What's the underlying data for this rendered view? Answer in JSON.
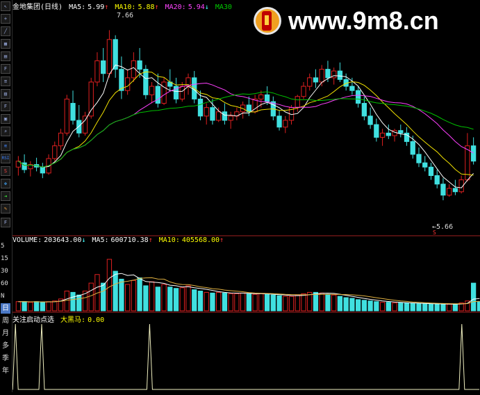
{
  "price_header": {
    "stock": "金地集团",
    "period": "(日线)",
    "ma5_label": "MA5:",
    "ma5": "5.99",
    "ma10_label": "MA10:",
    "ma10": "5.88",
    "ma20_label": "MA20:",
    "ma20": "5.94",
    "ma30_label": "MA30"
  },
  "annotations": {
    "high": "7.66",
    "low": "←5.66",
    "marker": "S"
  },
  "volume_header": {
    "label": "VOLUME:",
    "value": "203643.00",
    "ma5_label": "MA5:",
    "ma5": "600710.38",
    "ma10_label": "MA10:",
    "ma10": "405568.00"
  },
  "indicator_header": {
    "label": "关注启动点选",
    "name": "大黑马:",
    "value": "0.00"
  },
  "watermark": {
    "url": "www.9m8.cn"
  },
  "sidebar": {
    "tools": [
      "RSI",
      "S"
    ],
    "labels": [
      "5",
      "15",
      "30",
      "60",
      "N"
    ],
    "periods": [
      "日",
      "周",
      "月",
      "多",
      "季",
      "年"
    ]
  },
  "colors": {
    "up": "#e02020",
    "down": "#40e0e0",
    "ma5": "#ffffff",
    "ma10": "#f0e000",
    "ma20": "#ff40ff",
    "ma30": "#00c000",
    "vol_line": "#e0b040"
  },
  "chart_data": {
    "type": "candlestick",
    "price_range": [
      5.3,
      7.9
    ],
    "ohlc": [
      {
        "o": 6.05,
        "h": 6.18,
        "l": 5.95,
        "c": 6.12
      },
      {
        "o": 6.1,
        "h": 6.2,
        "l": 5.98,
        "c": 6.02
      },
      {
        "o": 6.03,
        "h": 6.12,
        "l": 5.94,
        "c": 6.08
      },
      {
        "o": 6.08,
        "h": 6.16,
        "l": 6.0,
        "c": 6.05
      },
      {
        "o": 6.05,
        "h": 6.1,
        "l": 5.92,
        "c": 5.98
      },
      {
        "o": 5.98,
        "h": 6.2,
        "l": 5.96,
        "c": 6.15
      },
      {
        "o": 6.15,
        "h": 6.35,
        "l": 6.12,
        "c": 6.3
      },
      {
        "o": 6.3,
        "h": 6.5,
        "l": 6.25,
        "c": 6.45
      },
      {
        "o": 6.45,
        "h": 6.9,
        "l": 6.42,
        "c": 6.85
      },
      {
        "o": 6.8,
        "h": 6.95,
        "l": 6.55,
        "c": 6.6
      },
      {
        "o": 6.6,
        "h": 6.78,
        "l": 6.4,
        "c": 6.45
      },
      {
        "o": 6.45,
        "h": 6.7,
        "l": 6.42,
        "c": 6.65
      },
      {
        "o": 6.65,
        "h": 7.1,
        "l": 6.62,
        "c": 7.05
      },
      {
        "o": 7.05,
        "h": 7.4,
        "l": 7.0,
        "c": 7.3
      },
      {
        "o": 7.3,
        "h": 7.45,
        "l": 7.05,
        "c": 7.15
      },
      {
        "o": 7.15,
        "h": 7.66,
        "l": 7.1,
        "c": 7.55
      },
      {
        "o": 7.55,
        "h": 7.6,
        "l": 7.1,
        "c": 7.2
      },
      {
        "o": 7.2,
        "h": 7.35,
        "l": 6.85,
        "c": 6.95
      },
      {
        "o": 6.95,
        "h": 7.2,
        "l": 6.9,
        "c": 7.1
      },
      {
        "o": 7.1,
        "h": 7.4,
        "l": 7.05,
        "c": 7.3
      },
      {
        "o": 7.3,
        "h": 7.45,
        "l": 7.1,
        "c": 7.2
      },
      {
        "o": 7.2,
        "h": 7.25,
        "l": 6.85,
        "c": 6.9
      },
      {
        "o": 6.9,
        "h": 7.05,
        "l": 6.8,
        "c": 7.0
      },
      {
        "o": 7.0,
        "h": 7.15,
        "l": 6.75,
        "c": 6.8
      },
      {
        "o": 6.8,
        "h": 7.1,
        "l": 6.78,
        "c": 7.05
      },
      {
        "o": 7.05,
        "h": 7.2,
        "l": 6.95,
        "c": 7.0
      },
      {
        "o": 7.0,
        "h": 7.1,
        "l": 6.8,
        "c": 6.85
      },
      {
        "o": 6.85,
        "h": 7.05,
        "l": 6.82,
        "c": 7.0
      },
      {
        "o": 7.0,
        "h": 7.15,
        "l": 6.9,
        "c": 7.1
      },
      {
        "o": 7.1,
        "h": 7.18,
        "l": 6.8,
        "c": 6.85
      },
      {
        "o": 6.85,
        "h": 6.95,
        "l": 6.6,
        "c": 6.65
      },
      {
        "o": 6.65,
        "h": 6.8,
        "l": 6.55,
        "c": 6.75
      },
      {
        "o": 6.75,
        "h": 6.85,
        "l": 6.55,
        "c": 6.6
      },
      {
        "o": 6.6,
        "h": 6.75,
        "l": 6.58,
        "c": 6.7
      },
      {
        "o": 6.7,
        "h": 6.8,
        "l": 6.55,
        "c": 6.6
      },
      {
        "o": 6.6,
        "h": 6.7,
        "l": 6.5,
        "c": 6.65
      },
      {
        "o": 6.65,
        "h": 6.75,
        "l": 6.6,
        "c": 6.7
      },
      {
        "o": 6.7,
        "h": 6.82,
        "l": 6.62,
        "c": 6.78
      },
      {
        "o": 6.78,
        "h": 6.88,
        "l": 6.65,
        "c": 6.7
      },
      {
        "o": 6.7,
        "h": 6.9,
        "l": 6.68,
        "c": 6.85
      },
      {
        "o": 6.85,
        "h": 6.95,
        "l": 6.75,
        "c": 6.9
      },
      {
        "o": 6.9,
        "h": 7.0,
        "l": 6.78,
        "c": 6.82
      },
      {
        "o": 6.82,
        "h": 6.88,
        "l": 6.6,
        "c": 6.65
      },
      {
        "o": 6.65,
        "h": 6.72,
        "l": 6.48,
        "c": 6.52
      },
      {
        "o": 6.52,
        "h": 6.65,
        "l": 6.45,
        "c": 6.6
      },
      {
        "o": 6.6,
        "h": 6.78,
        "l": 6.55,
        "c": 6.75
      },
      {
        "o": 6.75,
        "h": 6.9,
        "l": 6.7,
        "c": 6.88
      },
      {
        "o": 6.88,
        "h": 7.05,
        "l": 6.85,
        "c": 7.0
      },
      {
        "o": 7.0,
        "h": 7.15,
        "l": 6.95,
        "c": 7.1
      },
      {
        "o": 7.1,
        "h": 7.2,
        "l": 6.98,
        "c": 7.05
      },
      {
        "o": 7.05,
        "h": 7.25,
        "l": 7.0,
        "c": 7.2
      },
      {
        "o": 7.2,
        "h": 7.3,
        "l": 7.05,
        "c": 7.1
      },
      {
        "o": 7.1,
        "h": 7.22,
        "l": 7.02,
        "c": 7.18
      },
      {
        "o": 7.18,
        "h": 7.28,
        "l": 7.05,
        "c": 7.08
      },
      {
        "o": 7.08,
        "h": 7.15,
        "l": 6.95,
        "c": 7.0
      },
      {
        "o": 7.0,
        "h": 7.1,
        "l": 6.9,
        "c": 6.95
      },
      {
        "o": 6.95,
        "h": 7.0,
        "l": 6.75,
        "c": 6.8
      },
      {
        "o": 6.8,
        "h": 6.88,
        "l": 6.6,
        "c": 6.65
      },
      {
        "o": 6.65,
        "h": 6.75,
        "l": 6.5,
        "c": 6.55
      },
      {
        "o": 6.55,
        "h": 6.62,
        "l": 6.35,
        "c": 6.4
      },
      {
        "o": 6.4,
        "h": 6.5,
        "l": 6.3,
        "c": 6.45
      },
      {
        "o": 6.45,
        "h": 6.55,
        "l": 6.38,
        "c": 6.42
      },
      {
        "o": 6.42,
        "h": 6.5,
        "l": 6.35,
        "c": 6.48
      },
      {
        "o": 6.48,
        "h": 6.55,
        "l": 6.4,
        "c": 6.45
      },
      {
        "o": 6.45,
        "h": 6.52,
        "l": 6.3,
        "c": 6.35
      },
      {
        "o": 6.35,
        "h": 6.42,
        "l": 6.15,
        "c": 6.2
      },
      {
        "o": 6.2,
        "h": 6.28,
        "l": 6.05,
        "c": 6.1
      },
      {
        "o": 6.1,
        "h": 6.18,
        "l": 6.0,
        "c": 6.05
      },
      {
        "o": 6.05,
        "h": 6.1,
        "l": 5.9,
        "c": 5.95
      },
      {
        "o": 5.95,
        "h": 6.02,
        "l": 5.8,
        "c": 5.85
      },
      {
        "o": 5.85,
        "h": 5.92,
        "l": 5.66,
        "c": 5.72
      },
      {
        "o": 5.72,
        "h": 5.85,
        "l": 5.7,
        "c": 5.8
      },
      {
        "o": 5.8,
        "h": 5.9,
        "l": 5.72,
        "c": 5.76
      },
      {
        "o": 5.76,
        "h": 5.95,
        "l": 5.74,
        "c": 5.9
      },
      {
        "o": 5.9,
        "h": 6.45,
        "l": 5.88,
        "c": 6.3
      },
      {
        "o": 6.3,
        "h": 6.4,
        "l": 6.08,
        "c": 6.12
      }
    ],
    "volume": [
      0.14,
      0.14,
      0.13,
      0.14,
      0.13,
      0.14,
      0.15,
      0.18,
      0.3,
      0.28,
      0.24,
      0.3,
      0.42,
      0.55,
      0.42,
      0.78,
      0.6,
      0.48,
      0.4,
      0.46,
      0.5,
      0.38,
      0.44,
      0.36,
      0.4,
      0.36,
      0.34,
      0.35,
      0.38,
      0.32,
      0.3,
      0.28,
      0.27,
      0.28,
      0.27,
      0.26,
      0.26,
      0.27,
      0.26,
      0.25,
      0.26,
      0.25,
      0.24,
      0.23,
      0.22,
      0.22,
      0.24,
      0.26,
      0.28,
      0.28,
      0.27,
      0.25,
      0.24,
      0.22,
      0.2,
      0.19,
      0.17,
      0.16,
      0.15,
      0.14,
      0.13,
      0.13,
      0.12,
      0.12,
      0.12,
      0.11,
      0.11,
      0.11,
      0.1,
      0.1,
      0.1,
      0.1,
      0.1,
      0.12,
      0.15,
      0.42,
      0.14
    ],
    "signal_peaks": [
      1,
      10,
      47,
      154
    ]
  }
}
